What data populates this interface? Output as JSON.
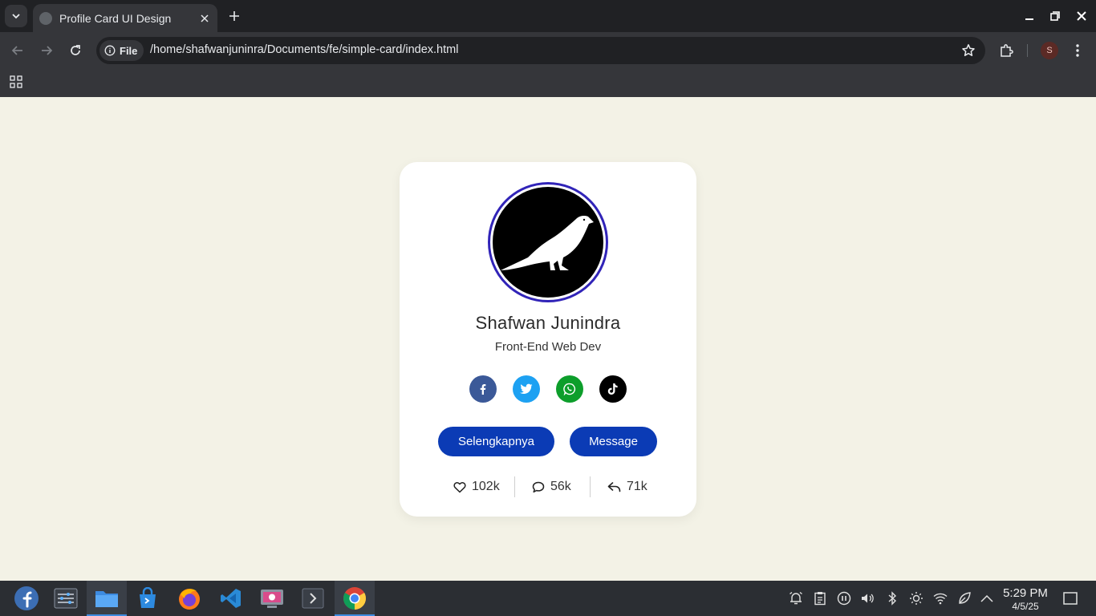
{
  "browser": {
    "tab_title": "Profile Card UI Design",
    "chip_label": "File",
    "url": "/home/shafwanjuninra/Documents/fe/simple-card/index.html",
    "profile_initial": "S"
  },
  "profile": {
    "name": "Shafwan Junindra",
    "role": "Front-End Web Dev",
    "socials": [
      {
        "name": "facebook",
        "icon": "facebook-icon",
        "color": "#3b5998"
      },
      {
        "name": "twitter",
        "icon": "twitter-icon",
        "color": "#1da1f2"
      },
      {
        "name": "whatsapp",
        "icon": "whatsapp-icon",
        "color": "#0d9e2b"
      },
      {
        "name": "tiktok",
        "icon": "tiktok-icon",
        "color": "#000000"
      }
    ],
    "buttons": {
      "primary": "Selengkapnya",
      "secondary": "Message"
    },
    "stats": {
      "likes": "102k",
      "comments": "56k",
      "shares": "71k"
    },
    "accent_color": "#0b3bb5",
    "avatar_ring_color": "#3124b8"
  },
  "taskbar": {
    "time": "5:29 PM",
    "date": "4/5/25",
    "apps": [
      "fedora-icon",
      "settings-icon",
      "files-icon",
      "software-icon",
      "firefox-icon",
      "vscode-icon",
      "screenshot-icon",
      "terminal-icon",
      "chrome-icon"
    ]
  },
  "colors": {
    "page_background": "#f3f2e6",
    "card_background": "#ffffff",
    "taskbar_background": "#2b2e33"
  }
}
